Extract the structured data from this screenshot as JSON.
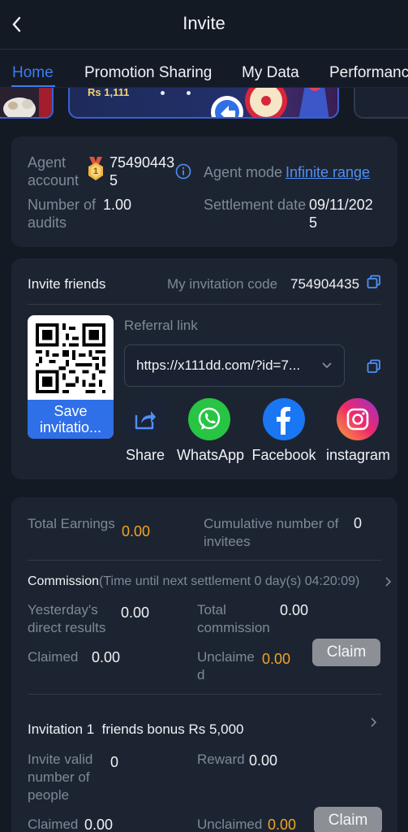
{
  "header": {
    "title": "Invite",
    "back_icon": "chevron-left-icon"
  },
  "tabs": [
    {
      "label": "Home",
      "active": true
    },
    {
      "label": "Promotion Sharing",
      "active": false
    },
    {
      "label": "My Data",
      "active": false
    },
    {
      "label": "Performance",
      "active": false
    }
  ],
  "banner": {
    "text": "Rs 1,111"
  },
  "agent": {
    "account_label": "Agent\naccount",
    "account_value": "75490443\n5",
    "mode_label": "Agent mode",
    "mode_value": "Infinite range",
    "audits_label": "Number of\naudits",
    "audits_value": "1.00",
    "settlement_label": "Settlement date",
    "settlement_value": "09/11/202\n5",
    "level_badge": "1"
  },
  "invite": {
    "title": "Invite friends",
    "code_label": "My invitation code",
    "code_value": "754904435",
    "referral_label": "Referral link",
    "referral_value": "https://x111dd.com/?id=7...",
    "save_label": "Save\ninvitatio...",
    "share_items": [
      {
        "label": "Share",
        "icon": "share-icon"
      },
      {
        "label": "WhatsApp",
        "icon": "whatsapp-icon"
      },
      {
        "label": "Facebook",
        "icon": "facebook-icon"
      },
      {
        "label": "instagram",
        "icon": "instagram-icon"
      }
    ]
  },
  "earnings": {
    "total_label": "Total Earnings",
    "total_value": "0.00",
    "invitees_label": "Cumulative number of\ninvitees",
    "invitees_value": "0",
    "commission_title": "Commission",
    "commission_note": "(Time until next settlement 0 day(s) 04:20:09)",
    "yesterday_label": "Yesterday's\ndirect results",
    "yesterday_value": "0.00",
    "total_commission_label": "Total\ncommission",
    "total_commission_value": "0.00",
    "claimed_label": "Claimed",
    "claimed_value": "0.00",
    "unclaimed_label": "Unclaime\nd",
    "unclaimed_value": "0.00",
    "claim_label": "Claim",
    "bonus_title": "Invitation 1  friends bonus Rs 5,000",
    "valid_label": "Invite valid\nnumber of\npeople",
    "valid_value": "0",
    "reward_label": "Reward",
    "reward_value": "0.00",
    "claimed2_label": "Claimed",
    "claimed2_value": "0.00",
    "unclaimed2_label": "Unclaimed",
    "unclaimed2_value": "0.00",
    "claim2_label": "Claim"
  },
  "colors": {
    "accent": "#3d7bf2",
    "earning": "#f0a623",
    "background": "#141a24",
    "card": "#1d2431"
  }
}
